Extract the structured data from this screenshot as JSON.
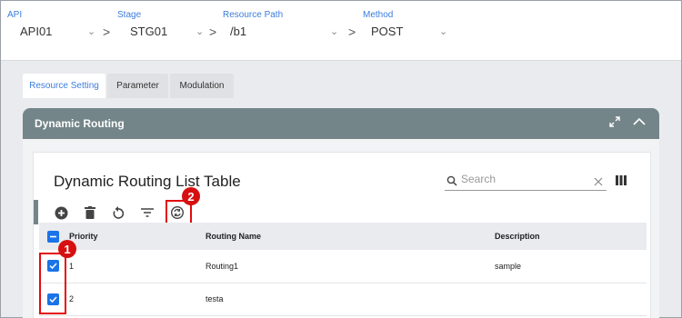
{
  "selectors": [
    {
      "label": "API",
      "value": "API01"
    },
    {
      "label": "Stage",
      "value": "STG01"
    },
    {
      "label": "Resource Path",
      "value": "/b1"
    },
    {
      "label": "Method",
      "value": "POST"
    }
  ],
  "tabs": [
    "Resource Setting",
    "Parameter",
    "Modulation"
  ],
  "panel": {
    "title": "Dynamic Routing"
  },
  "card": {
    "title": "Dynamic Routing List Table",
    "search_placeholder": "Search"
  },
  "table": {
    "headers": [
      "Priority",
      "Routing Name",
      "Description"
    ],
    "rows": [
      {
        "priority": "1",
        "name": "Routing1",
        "description": "sample"
      },
      {
        "priority": "2",
        "name": "testa",
        "description": ""
      }
    ]
  },
  "badges": [
    "1",
    "2"
  ],
  "colors": {
    "accent": "#3b7ddd",
    "header": "#748589",
    "callout": "#e30b0b",
    "checkbox": "#1a73e8"
  }
}
